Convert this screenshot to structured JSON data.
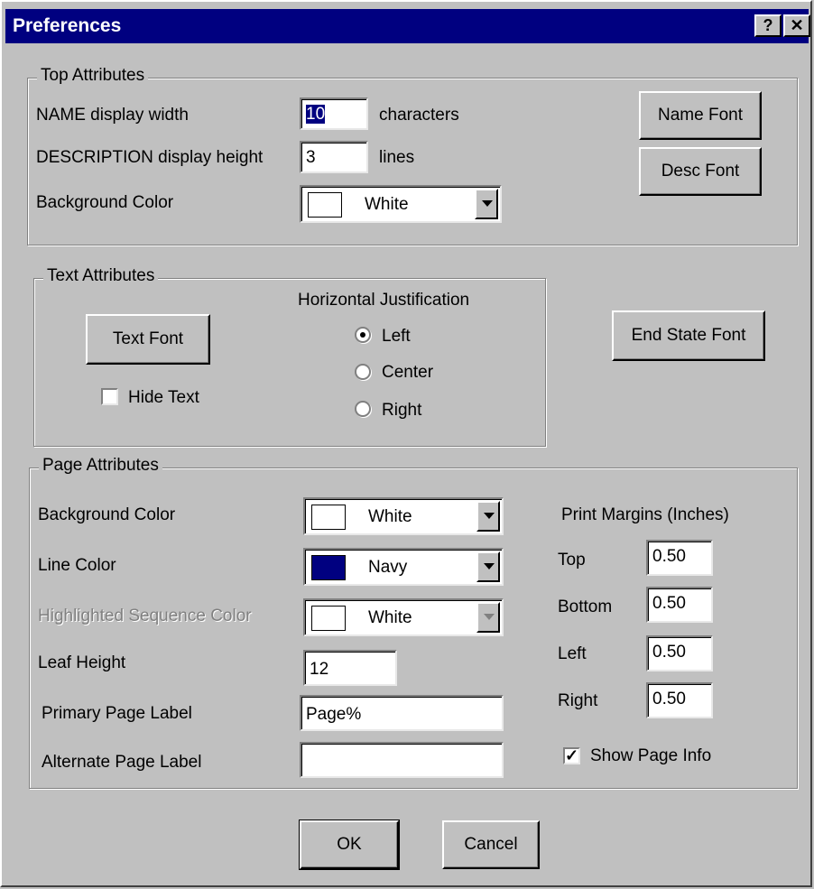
{
  "window": {
    "title": "Preferences",
    "help_icon": "?",
    "close_icon": "✕"
  },
  "top": {
    "legend": "Top Attributes",
    "name_width_label": "NAME display width",
    "name_width_value": "10",
    "name_width_unit": "characters",
    "desc_height_label": "DESCRIPTION display height",
    "desc_height_value": "3",
    "desc_height_unit": "lines",
    "bg_color_label": "Background Color",
    "bg_color_value": "White",
    "name_font_button": "Name Font",
    "desc_font_button": "Desc Font"
  },
  "text": {
    "legend": "Text Attributes",
    "justification_label": "Horizontal Justification",
    "text_font_button": "Text Font",
    "hide_text_label": "Hide Text",
    "hide_text_checked": false,
    "options": [
      "Left",
      "Center",
      "Right"
    ],
    "selected": "Left"
  },
  "end_state_font_button": "End State Font",
  "page": {
    "legend": "Page Attributes",
    "bg_color_label": "Background Color",
    "bg_color_value": "White",
    "line_color_label": "Line Color",
    "line_color_value": "Navy",
    "highlight_label": "Highlighted Sequence Color",
    "highlight_value": "White",
    "leaf_height_label": "Leaf Height",
    "leaf_height_value": "12",
    "primary_label": "Primary Page Label",
    "primary_value": "Page%",
    "alternate_label": "Alternate Page Label",
    "alternate_value": "",
    "margins_title": "Print Margins (Inches)",
    "top_label": "Top",
    "top_value": "0.50",
    "bottom_label": "Bottom",
    "bottom_value": "0.50",
    "left_label": "Left",
    "left_value": "0.50",
    "right_label": "Right",
    "right_value": "0.50",
    "show_info_label": "Show Page Info",
    "show_info_checked": true
  },
  "buttons": {
    "ok": "OK",
    "cancel": "Cancel"
  },
  "colors": {
    "titlebar": "#000080",
    "face": "#c0c0c0",
    "white": "#ffffff",
    "navy": "#000080"
  }
}
